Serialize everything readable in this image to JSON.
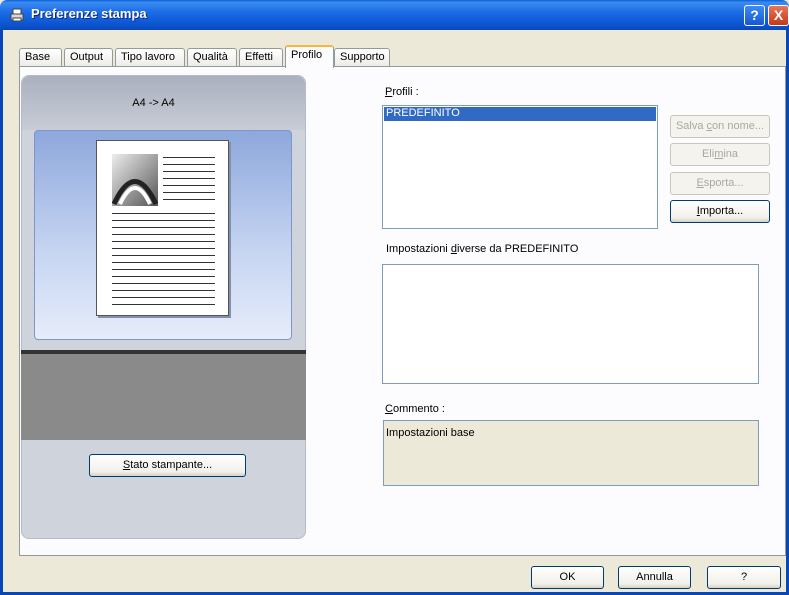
{
  "window": {
    "title": "Preferenze stampa",
    "help_glyph": "?",
    "close_glyph": "X"
  },
  "tabs": [
    {
      "label": "Base"
    },
    {
      "label": "Output"
    },
    {
      "label": "Tipo lavoro"
    },
    {
      "label": "Qualità"
    },
    {
      "label": "Effetti"
    },
    {
      "label": "Profilo",
      "active": true
    },
    {
      "label": "Supporto"
    }
  ],
  "preview": {
    "page_size": "A4 -> A4",
    "status_button": {
      "ul": "S",
      "rest": "tato stampante..."
    }
  },
  "profiles": {
    "label_ul": "P",
    "label_rest": "rofili :",
    "items": [
      "PREDEFINITO"
    ],
    "selected": "PREDEFINITO",
    "save_as": {
      "pre": "Salva ",
      "ul": "c",
      "post": "on nome..."
    },
    "delete": {
      "pre": "Eli",
      "ul": "m",
      "post": "ina"
    },
    "export": {
      "pre": "",
      "ul": "E",
      "post": "sporta..."
    },
    "import": {
      "pre": "",
      "ul": "I",
      "post": "mporta..."
    }
  },
  "differences": {
    "label_pre": "Impostazioni ",
    "label_ul": "d",
    "label_post": "iverse da PREDEFINITO"
  },
  "comment": {
    "label_ul": "C",
    "label_rest": "ommento :",
    "value": "Impostazioni base"
  },
  "footer": {
    "ok": "OK",
    "cancel": "Annulla",
    "help": "?"
  }
}
